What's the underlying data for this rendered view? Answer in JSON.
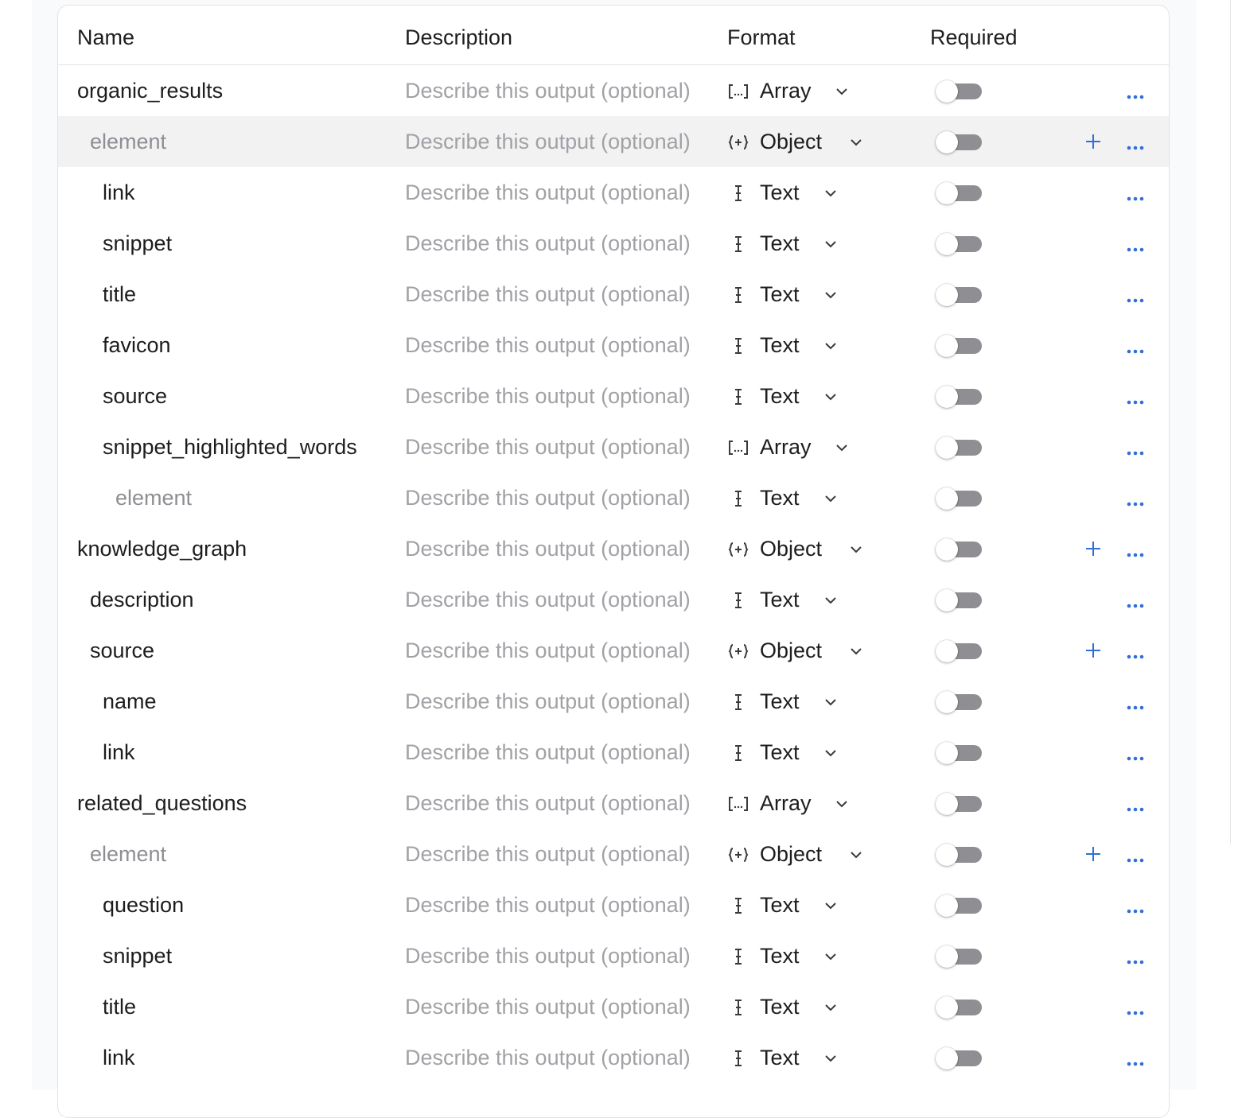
{
  "header": {
    "name": "Name",
    "description": "Description",
    "format": "Format",
    "required": "Required"
  },
  "colors": {
    "accent": "#2f6fd6",
    "muted_text": "#a1a1a6",
    "toggle_off": "#8e8e93",
    "highlight_row": "#f2f2f3"
  },
  "rows": [
    {
      "name": "organic_results",
      "level": 0,
      "muted": false,
      "description_placeholder": "Describe this output (optional)",
      "format": "Array",
      "format_icon": "array-icon",
      "required": false,
      "has_add": false,
      "highlighted": false
    },
    {
      "name": "element",
      "level": 1,
      "muted": true,
      "description_placeholder": "Describe this output (optional)",
      "format": "Object",
      "format_icon": "object-icon",
      "required": false,
      "has_add": true,
      "highlighted": true
    },
    {
      "name": "link",
      "level": 2,
      "muted": false,
      "description_placeholder": "Describe this output (optional)",
      "format": "Text",
      "format_icon": "text-cursor-icon",
      "required": false,
      "has_add": false,
      "highlighted": false
    },
    {
      "name": "snippet",
      "level": 2,
      "muted": false,
      "description_placeholder": "Describe this output (optional)",
      "format": "Text",
      "format_icon": "text-cursor-icon",
      "required": false,
      "has_add": false,
      "highlighted": false
    },
    {
      "name": "title",
      "level": 2,
      "muted": false,
      "description_placeholder": "Describe this output (optional)",
      "format": "Text",
      "format_icon": "text-cursor-icon",
      "required": false,
      "has_add": false,
      "highlighted": false
    },
    {
      "name": "favicon",
      "level": 2,
      "muted": false,
      "description_placeholder": "Describe this output (optional)",
      "format": "Text",
      "format_icon": "text-cursor-icon",
      "required": false,
      "has_add": false,
      "highlighted": false
    },
    {
      "name": "source",
      "level": 2,
      "muted": false,
      "description_placeholder": "Describe this output (optional)",
      "format": "Text",
      "format_icon": "text-cursor-icon",
      "required": false,
      "has_add": false,
      "highlighted": false
    },
    {
      "name": "snippet_highlighted_words",
      "level": 2,
      "muted": false,
      "description_placeholder": "Describe this output (optional)",
      "format": "Array",
      "format_icon": "array-icon",
      "required": false,
      "has_add": false,
      "highlighted": false
    },
    {
      "name": "element",
      "level": 3,
      "muted": true,
      "description_placeholder": "Describe this output (optional)",
      "format": "Text",
      "format_icon": "text-cursor-icon",
      "required": false,
      "has_add": false,
      "highlighted": false
    },
    {
      "name": "knowledge_graph",
      "level": 0,
      "muted": false,
      "description_placeholder": "Describe this output (optional)",
      "format": "Object",
      "format_icon": "object-icon",
      "required": false,
      "has_add": true,
      "highlighted": false
    },
    {
      "name": "description",
      "level": 1,
      "muted": false,
      "description_placeholder": "Describe this output (optional)",
      "format": "Text",
      "format_icon": "text-cursor-icon",
      "required": false,
      "has_add": false,
      "highlighted": false
    },
    {
      "name": "source",
      "level": 1,
      "muted": false,
      "description_placeholder": "Describe this output (optional)",
      "format": "Object",
      "format_icon": "object-icon",
      "required": false,
      "has_add": true,
      "highlighted": false
    },
    {
      "name": "name",
      "level": 2,
      "muted": false,
      "description_placeholder": "Describe this output (optional)",
      "format": "Text",
      "format_icon": "text-cursor-icon",
      "required": false,
      "has_add": false,
      "highlighted": false
    },
    {
      "name": "link",
      "level": 2,
      "muted": false,
      "description_placeholder": "Describe this output (optional)",
      "format": "Text",
      "format_icon": "text-cursor-icon",
      "required": false,
      "has_add": false,
      "highlighted": false
    },
    {
      "name": "related_questions",
      "level": 0,
      "muted": false,
      "description_placeholder": "Describe this output (optional)",
      "format": "Array",
      "format_icon": "array-icon",
      "required": false,
      "has_add": false,
      "highlighted": false
    },
    {
      "name": "element",
      "level": 1,
      "muted": true,
      "description_placeholder": "Describe this output (optional)",
      "format": "Object",
      "format_icon": "object-icon",
      "required": false,
      "has_add": true,
      "highlighted": false
    },
    {
      "name": "question",
      "level": 2,
      "muted": false,
      "description_placeholder": "Describe this output (optional)",
      "format": "Text",
      "format_icon": "text-cursor-icon",
      "required": false,
      "has_add": false,
      "highlighted": false
    },
    {
      "name": "snippet",
      "level": 2,
      "muted": false,
      "description_placeholder": "Describe this output (optional)",
      "format": "Text",
      "format_icon": "text-cursor-icon",
      "required": false,
      "has_add": false,
      "highlighted": false
    },
    {
      "name": "title",
      "level": 2,
      "muted": false,
      "description_placeholder": "Describe this output (optional)",
      "format": "Text",
      "format_icon": "text-cursor-icon",
      "required": false,
      "has_add": false,
      "highlighted": false
    },
    {
      "name": "link",
      "level": 2,
      "muted": false,
      "description_placeholder": "Describe this output (optional)",
      "format": "Text",
      "format_icon": "text-cursor-icon",
      "required": false,
      "has_add": false,
      "highlighted": false
    }
  ]
}
